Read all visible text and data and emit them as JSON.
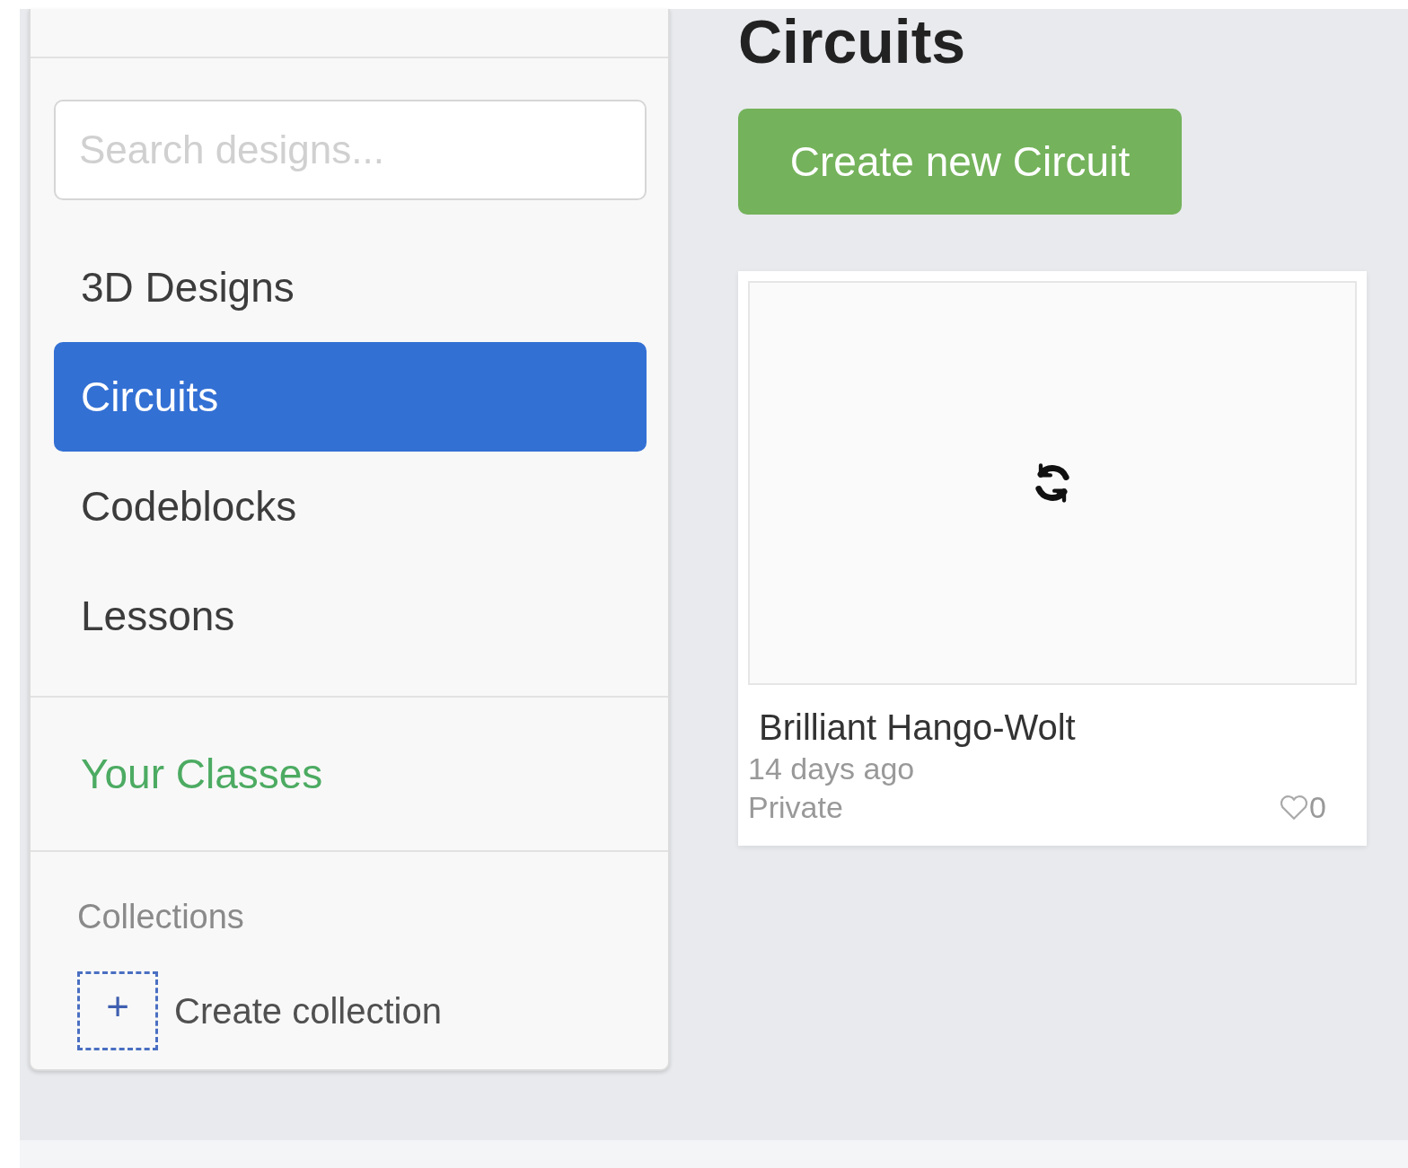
{
  "sidebar": {
    "search": {
      "placeholder": "Search designs..."
    },
    "items": [
      {
        "label": "3D Designs",
        "selected": false
      },
      {
        "label": "Circuits",
        "selected": true
      },
      {
        "label": "Codeblocks",
        "selected": false
      },
      {
        "label": "Lessons",
        "selected": false
      }
    ],
    "classes_link": "Your Classes",
    "collections": {
      "heading": "Collections",
      "create_icon": "+",
      "create_label": "Create collection"
    }
  },
  "main": {
    "title": "Circuits",
    "create_button": "Create new Circuit",
    "designs": [
      {
        "name": "Brilliant Hango-Wolt",
        "updated": "14 days ago",
        "visibility": "Private",
        "likes": "0"
      }
    ]
  }
}
